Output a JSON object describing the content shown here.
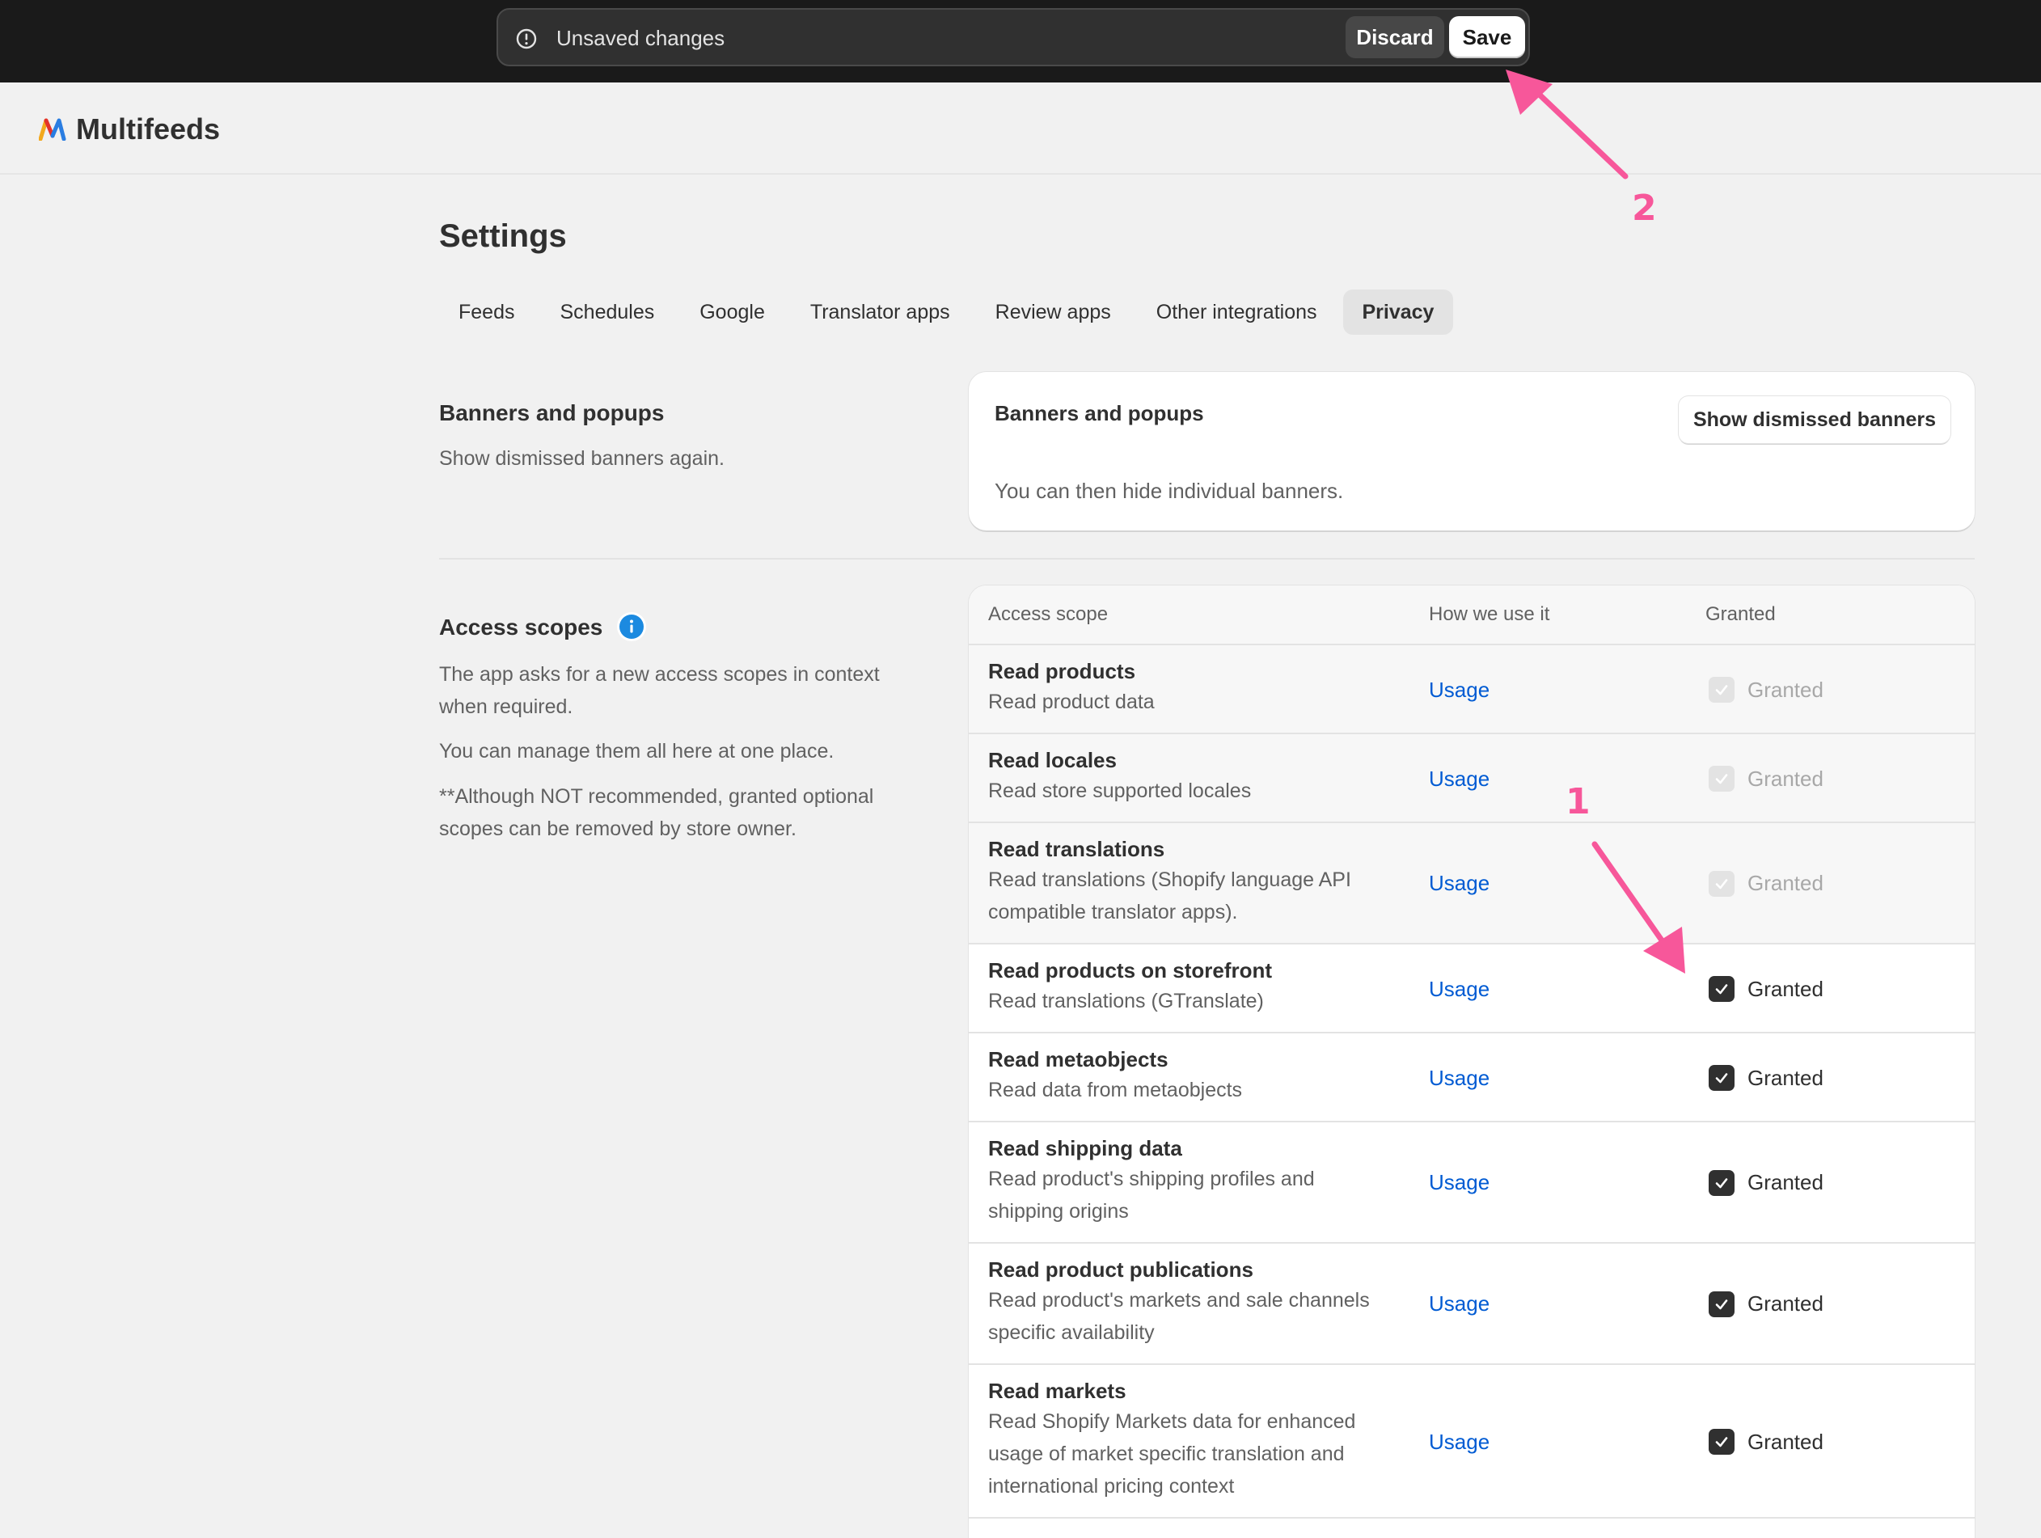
{
  "save_bar": {
    "message": "Unsaved changes",
    "discard_label": "Discard",
    "save_label": "Save"
  },
  "app": {
    "name": "Multifeeds",
    "logo_colors": [
      "#f2a81d",
      "#e4322b",
      "#2a7de1"
    ]
  },
  "page": {
    "title": "Settings",
    "tabs": [
      {
        "label": "Feeds",
        "active": false
      },
      {
        "label": "Schedules",
        "active": false
      },
      {
        "label": "Google",
        "active": false
      },
      {
        "label": "Translator apps",
        "active": false
      },
      {
        "label": "Review apps",
        "active": false
      },
      {
        "label": "Other integrations",
        "active": false
      },
      {
        "label": "Privacy",
        "active": true
      }
    ]
  },
  "banners": {
    "section_title": "Banners and popups",
    "section_text": "Show dismissed banners again.",
    "card_title": "Banners and popups",
    "card_text": "You can then hide individual banners.",
    "button_label": "Show dismissed banners"
  },
  "access": {
    "section_title": "Access scopes",
    "info_icon": "info-icon",
    "text_1": "The app asks for a new access scopes in context when required.",
    "text_2": "You can manage them all here at one place.",
    "text_3": "**Although NOT recommended, granted optional scopes can be removed by store owner.",
    "columns": [
      "Access scope",
      "How we use it",
      "Granted"
    ],
    "rows": [
      {
        "name": "Read products",
        "desc": "Read product data",
        "link": "Usage",
        "granted": "Granted",
        "checked": true,
        "disabled": true
      },
      {
        "name": "Read locales",
        "desc": "Read store supported locales",
        "link": "Usage",
        "granted": "Granted",
        "checked": true,
        "disabled": true
      },
      {
        "name": "Read translations",
        "desc": "Read translations (Shopify language API compatible translator apps).",
        "link": "Usage",
        "granted": "Granted",
        "checked": true,
        "disabled": true
      },
      {
        "name": "Read products on storefront",
        "desc": "Read translations (GTranslate)",
        "link": "Usage",
        "granted": "Granted",
        "checked": true,
        "disabled": false
      },
      {
        "name": "Read metaobjects",
        "desc": "Read data from metaobjects",
        "link": "Usage",
        "granted": "Granted",
        "checked": true,
        "disabled": false
      },
      {
        "name": "Read shipping data",
        "desc": "Read product's shipping profiles and shipping origins",
        "link": "Usage",
        "granted": "Granted",
        "checked": true,
        "disabled": false
      },
      {
        "name": "Read product publications",
        "desc": "Read product's markets and sale channels specific availability",
        "link": "Usage",
        "granted": "Granted",
        "checked": true,
        "disabled": false
      },
      {
        "name": "Read markets",
        "desc": "Read Shopify Markets data for enhanced usage of market specific translation and international pricing context",
        "link": "Usage",
        "granted": "Granted",
        "checked": true,
        "disabled": false
      }
    ]
  },
  "annotations": {
    "label_1": "1",
    "label_2": "2",
    "color": "#f7579a"
  }
}
